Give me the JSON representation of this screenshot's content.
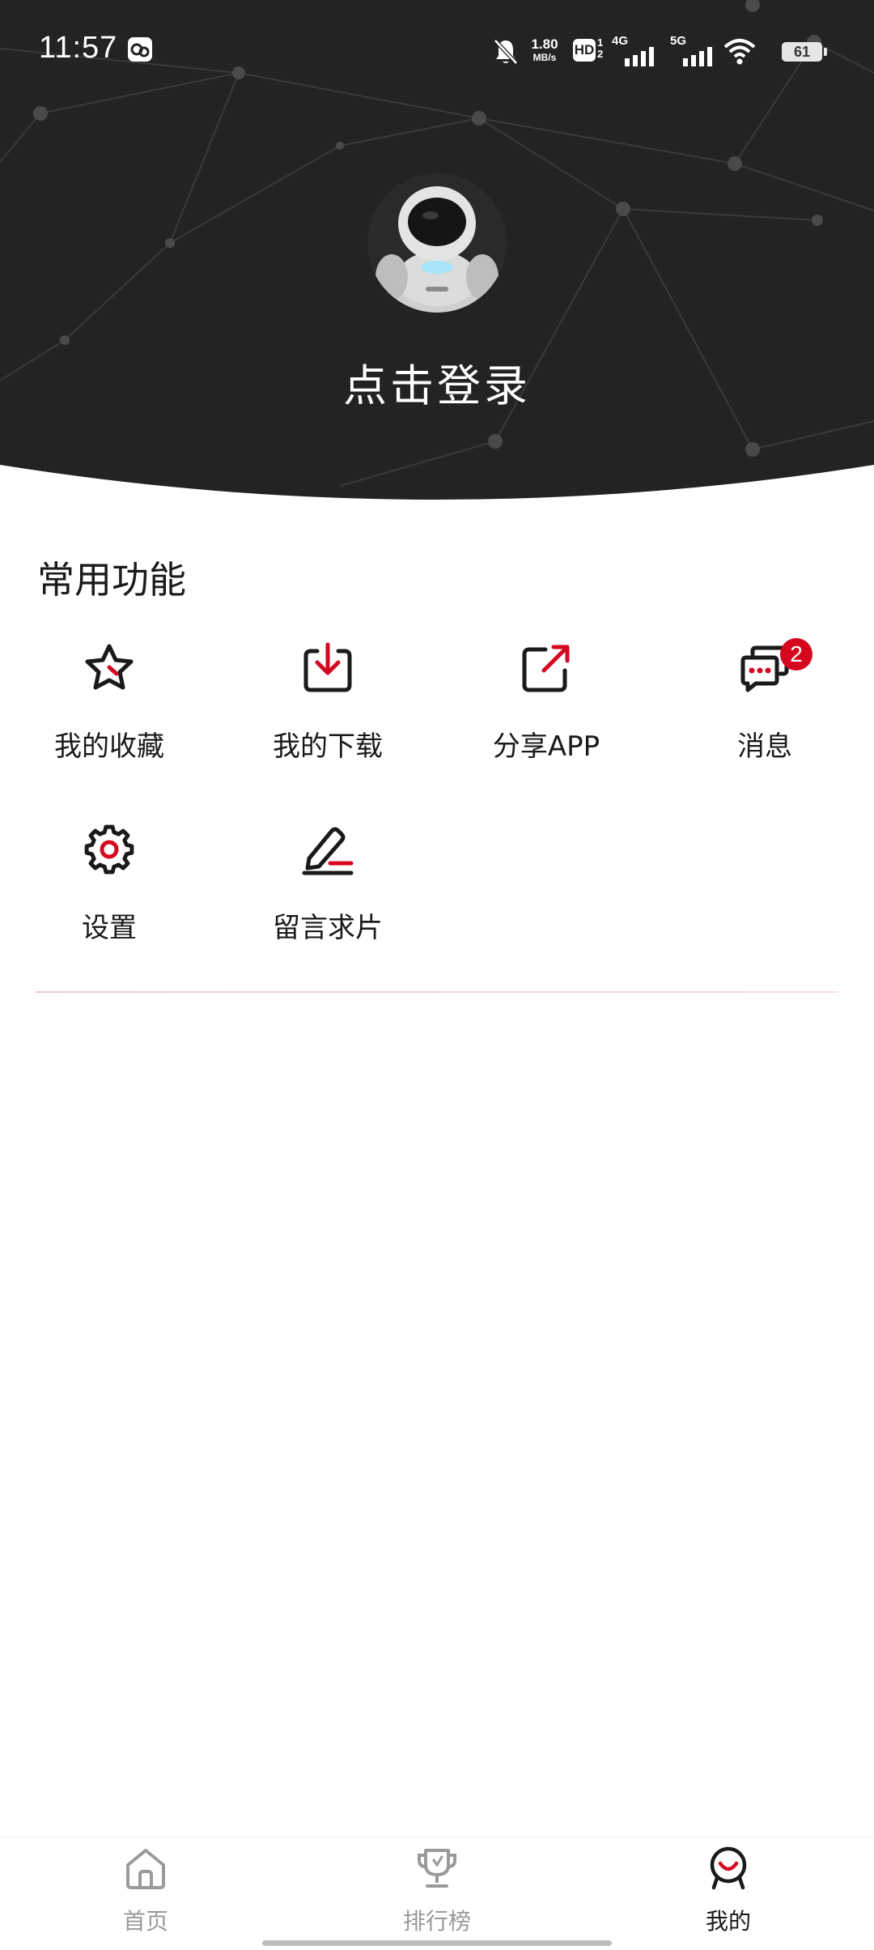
{
  "status_bar": {
    "time": "11:57",
    "net_speed_value": "1.80",
    "net_speed_unit": "MB/s",
    "hd_label": "HD",
    "sim1_label": "4G",
    "sim2_label": "5G",
    "battery": "61"
  },
  "header": {
    "login_text": "点击登录"
  },
  "section": {
    "title": "常用功能"
  },
  "functions": [
    {
      "label": "我的收藏",
      "icon": "star-icon"
    },
    {
      "label": "我的下载",
      "icon": "download-icon"
    },
    {
      "label": "分享APP",
      "icon": "share-icon"
    },
    {
      "label": "消息",
      "icon": "message-icon",
      "badge": "2"
    },
    {
      "label": "设置",
      "icon": "gear-icon"
    },
    {
      "label": "留言求片",
      "icon": "edit-icon"
    }
  ],
  "bottom_nav": [
    {
      "label": "首页",
      "icon": "home-icon",
      "active": false
    },
    {
      "label": "排行榜",
      "icon": "trophy-icon",
      "active": false
    },
    {
      "label": "我的",
      "icon": "profile-icon",
      "active": true
    }
  ],
  "colors": {
    "accent": "#d5071f",
    "header_bg": "#232323",
    "text": "#1a1a1a",
    "inactive": "#9a9a9a"
  }
}
